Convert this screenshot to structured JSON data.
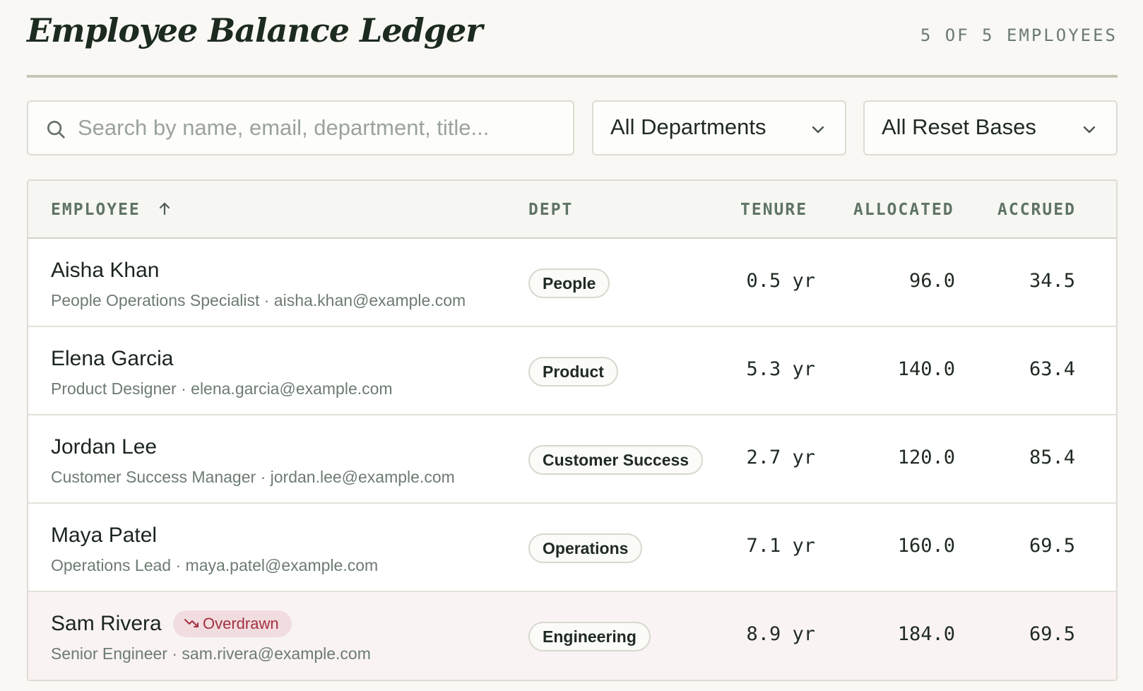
{
  "header": {
    "title": "Employee Balance Ledger",
    "count_label": "5 OF 5 EMPLOYEES"
  },
  "filters": {
    "search_placeholder": "Search by name, email, department, title...",
    "department_selected": "All Departments",
    "reset_basis_selected": "All Reset Bases"
  },
  "table": {
    "columns": {
      "employee": "EMPLOYEE",
      "dept": "DEPT",
      "tenure": "TENURE",
      "allocated": "ALLOCATED",
      "accrued": "ACCRUED"
    },
    "sort": {
      "column": "employee",
      "direction": "ascending"
    },
    "rows": [
      {
        "name": "Aisha Khan",
        "title": "People Operations Specialist",
        "email": "aisha.khan@example.com",
        "dept": "People",
        "tenure": "0.5 yr",
        "allocated": "96.0",
        "accrued": "34.5",
        "status": ""
      },
      {
        "name": "Elena Garcia",
        "title": "Product Designer",
        "email": "elena.garcia@example.com",
        "dept": "Product",
        "tenure": "5.3 yr",
        "allocated": "140.0",
        "accrued": "63.4",
        "status": ""
      },
      {
        "name": "Jordan Lee",
        "title": "Customer Success Manager",
        "email": "jordan.lee@example.com",
        "dept": "Customer Success",
        "tenure": "2.7 yr",
        "allocated": "120.0",
        "accrued": "85.4",
        "status": ""
      },
      {
        "name": "Maya Patel",
        "title": "Operations Lead",
        "email": "maya.patel@example.com",
        "dept": "Operations",
        "tenure": "7.1 yr",
        "allocated": "160.0",
        "accrued": "69.5",
        "status": ""
      },
      {
        "name": "Sam Rivera",
        "title": "Senior Engineer",
        "email": "sam.rivera@example.com",
        "dept": "Engineering",
        "tenure": "8.9 yr",
        "allocated": "184.0",
        "accrued": "69.5",
        "status": "Overdrawn"
      }
    ]
  },
  "colors": {
    "background": "#f9f8f5",
    "text": "#1f2a22",
    "muted": "#6d7b72",
    "header_text": "#5f7366",
    "overdrawn_bg": "#f1dde0",
    "overdrawn_text": "#a3303f",
    "overdrawn_row": "#f9f3f4"
  },
  "icons": {
    "search": "search-icon",
    "select": "chevron-down-icon",
    "sort": "arrow-up-icon",
    "overdrawn": "trend-down-icon"
  }
}
